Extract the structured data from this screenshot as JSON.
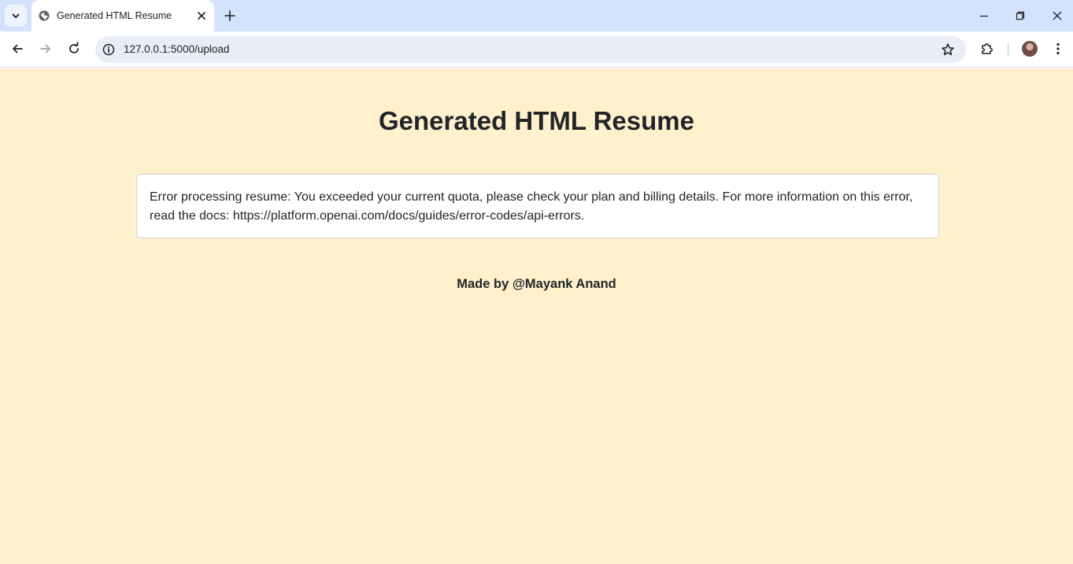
{
  "browser": {
    "tab": {
      "title": "Generated HTML Resume"
    },
    "address_bar": {
      "url": "127.0.0.1:5000/upload"
    }
  },
  "page": {
    "title": "Generated HTML Resume",
    "error_message": "Error processing resume: You exceeded your current quota, please check your plan and billing details. For more information on this error, read the docs: https://platform.openai.com/docs/guides/error-codes/api-errors.",
    "footer": "Made by @Mayank Anand"
  },
  "colors": {
    "page_background": "#fff1cc",
    "tabstrip_background": "#d3e3fd",
    "text": "#212529"
  }
}
